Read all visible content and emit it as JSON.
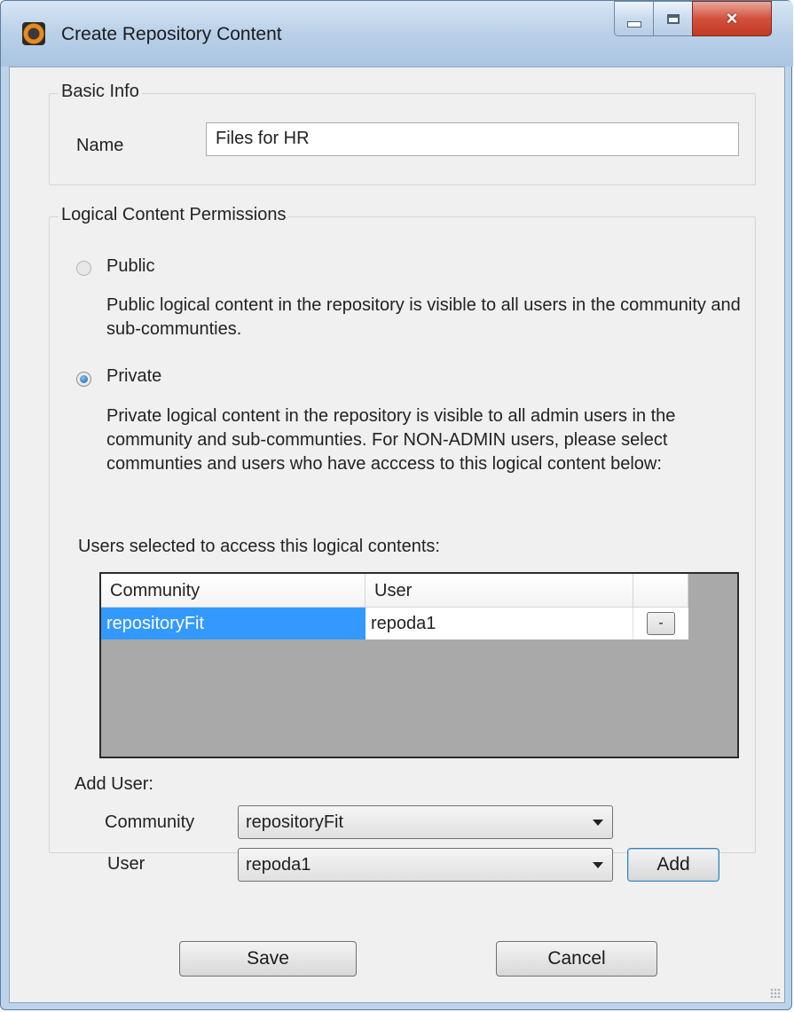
{
  "window": {
    "title": "Create Repository Content",
    "icon": "app-logo-icon",
    "controls": {
      "minimize": "minimize-icon",
      "maximize": "maximize-icon",
      "close": "×"
    }
  },
  "basic_info": {
    "legend": "Basic Info",
    "name_label": "Name",
    "name_value": "Files for HR"
  },
  "permissions": {
    "legend": "Logical Content Permissions",
    "public_label": "Public",
    "public_desc": "Public logical content in the repository is visible to all users in the community and sub-communties.",
    "private_label": "Private",
    "private_desc": "Private logical content in the repository is visible to all admin users in the community and sub-communties. For NON-ADMIN users, please select communties and users who have acccess to this logical content below:",
    "selected": "Private",
    "users_selected_label": "Users selected to access this logical contents:"
  },
  "table": {
    "columns": [
      "Community",
      "User",
      ""
    ],
    "rows": [
      {
        "community": "repositoryFit",
        "user": "repoda1",
        "action": "-"
      }
    ]
  },
  "add_user": {
    "label": "Add User:",
    "community_label": "Community",
    "community_value": "repositoryFit",
    "user_label": "User",
    "user_value": "repoda1",
    "add_button": "Add"
  },
  "footer": {
    "save": "Save",
    "cancel": "Cancel"
  }
}
